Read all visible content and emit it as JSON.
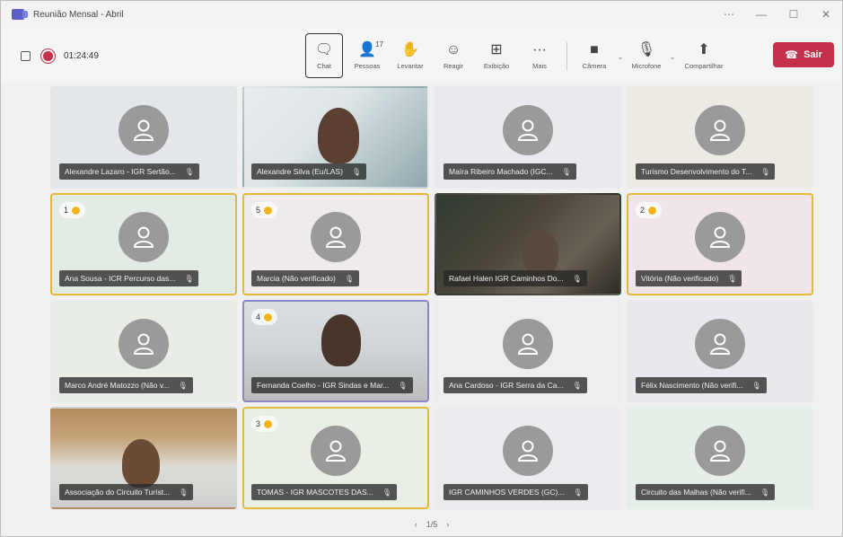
{
  "window": {
    "title": "Reunião Mensal - Abril",
    "controls": [
      "⋯",
      "—",
      "☐",
      "✕"
    ]
  },
  "toolbar": {
    "timer": "01:24:49",
    "tools": [
      {
        "name": "chat",
        "label": "Chat",
        "icon": "chat-icon",
        "glyph": "🗨"
      },
      {
        "name": "people",
        "label": "Pessoas",
        "icon": "people-icon",
        "glyph": "👤",
        "count": "17"
      },
      {
        "name": "raise",
        "label": "Levantar",
        "icon": "raise-hand-icon",
        "glyph": "✋"
      },
      {
        "name": "react",
        "label": "Reagir",
        "icon": "emoji-icon",
        "glyph": "☺"
      },
      {
        "name": "view",
        "label": "Exibição",
        "icon": "grid-view-icon",
        "glyph": "⊞"
      },
      {
        "name": "more",
        "label": "Mais",
        "icon": "more-icon",
        "glyph": "···"
      }
    ],
    "av": [
      {
        "name": "camera",
        "label": "Câmera",
        "icon": "camera-icon",
        "glyph": "■"
      },
      {
        "name": "mic",
        "label": "Microfone",
        "icon": "mic-off-icon",
        "glyph": "🎙"
      },
      {
        "name": "share",
        "label": "Compartilhar",
        "icon": "share-icon",
        "glyph": "⬆"
      }
    ],
    "leave_label": "Sair"
  },
  "tiles": [
    {
      "name": "Alexandre Lazaro - IGR Sertão...",
      "type": "avatar",
      "bg": "#e3e6ea"
    },
    {
      "name": "Alexandre Silva (Eu/LAS)",
      "type": "video",
      "v": "vid1"
    },
    {
      "name": "Maíra Ribeiro Machado (IGC...",
      "type": "avatar",
      "bg": "#e9e9ef"
    },
    {
      "name": "Turismo Desenvolvimento do T...",
      "type": "avatar",
      "bg": "#eceae2"
    },
    {
      "name": "Ana Sousa - ICR Percurso das...",
      "type": "avatar",
      "bg": "#e2ece4",
      "hand": "1"
    },
    {
      "name": "Marcia (Não verificado)",
      "type": "avatar",
      "bg": "#eeeaee",
      "hand": "5"
    },
    {
      "name": "Rafael Halen IGR Caminhos Do...",
      "type": "video",
      "v": "vid2"
    },
    {
      "name": "Vitória (Não verificado)",
      "type": "avatar",
      "bg": "#f0e6ea",
      "hand": "2"
    },
    {
      "name": "Marco André Matozzo (Não v...",
      "type": "avatar",
      "bg": "#e8eee6"
    },
    {
      "name": "Fernanda Coelho - IGR Sindas e Mar...",
      "type": "video",
      "v": "vid3",
      "hand": "4"
    },
    {
      "name": "Ana Cardoso - IGR Serra da Ca...",
      "type": "avatar",
      "bg": "#eeeeee"
    },
    {
      "name": "Félix Nascimento (Não verifi...",
      "type": "avatar",
      "bg": "#e9e8ee"
    },
    {
      "name": "Associação do Circuito Turíst...",
      "type": "video",
      "v": "vid4"
    },
    {
      "name": "TOMAS - IGR MASCOTES DAS...",
      "type": "avatar",
      "bg": "#e8efe4",
      "hand": "3"
    },
    {
      "name": "IGR CAMINHOS VERDES (GC)...",
      "type": "avatar",
      "bg": "#ebebf0"
    },
    {
      "name": "Circuito das Malhas (Não verifi...",
      "type": "avatar",
      "bg": "#e6eee8"
    }
  ],
  "pager": {
    "prev": "‹",
    "label": "1/5",
    "next": "›"
  }
}
